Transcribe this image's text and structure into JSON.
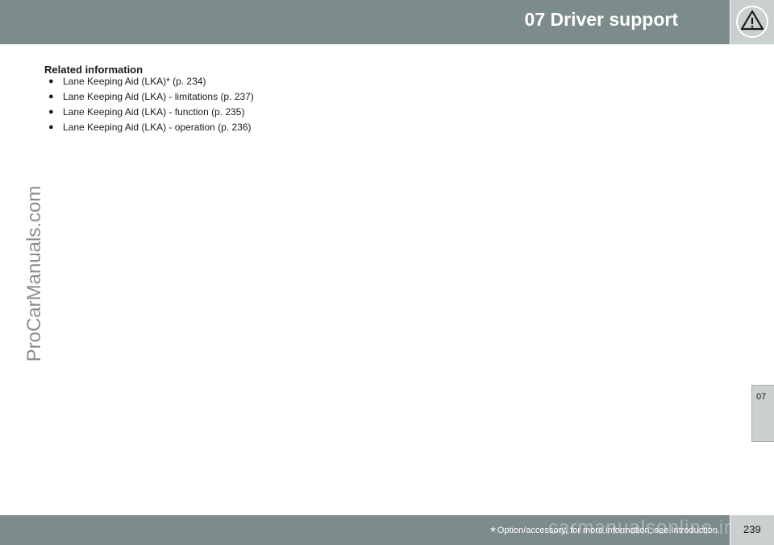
{
  "header": {
    "chapter_title": "07 Driver support",
    "icon": "warning-triangle-icon"
  },
  "watermark": {
    "side_text": "ProCarManuals.com",
    "footer_text": "carmanualsonline.info"
  },
  "related": {
    "title": "Related information",
    "items": [
      "Lane Keeping Aid (LKA)* (p. 234)",
      "Lane Keeping Aid (LKA) - limitations (p. 237)",
      "Lane Keeping Aid (LKA) - function (p. 235)",
      "Lane Keeping Aid (LKA) - operation (p. 236)"
    ]
  },
  "chapter_tab": {
    "label": "07"
  },
  "footer": {
    "asterisk": "*",
    "note": "Option/accessory, for more information, see Introduction.",
    "page_number": "239"
  },
  "colors": {
    "header_bg": "#7b8c8a",
    "tab_bg": "#c9d0cf"
  }
}
